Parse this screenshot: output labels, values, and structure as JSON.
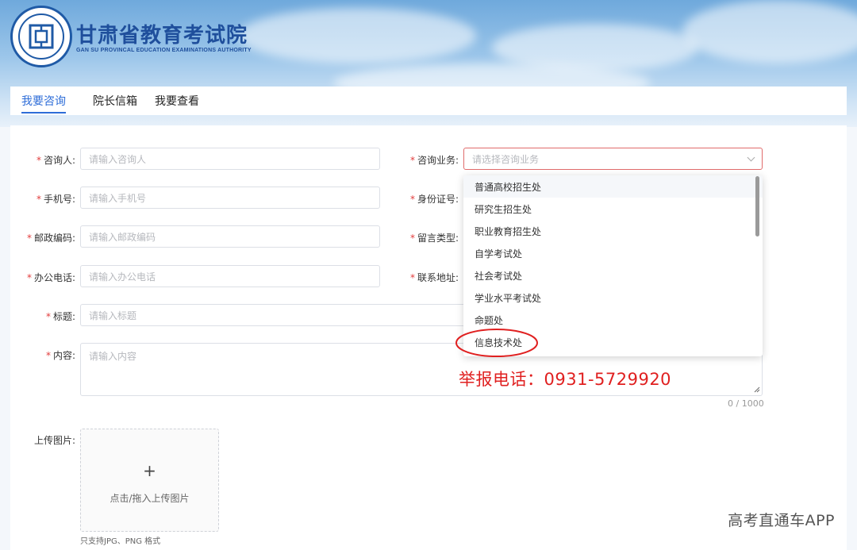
{
  "brand": {
    "title": "甘肃省教育考试院",
    "subtitle": "GAN SU PROVINCAL EDUCATION EXAMINATIONS AUTHORITY",
    "color": "#1f4f9c"
  },
  "tabs": [
    {
      "label": "我要咨询",
      "active": true
    },
    {
      "label": "院长信箱",
      "active": false
    },
    {
      "label": "我要查看",
      "active": false
    }
  ],
  "form": {
    "inquirer": {
      "label": "咨询人:",
      "placeholder": "请输入咨询人"
    },
    "business": {
      "label": "咨询业务:",
      "placeholder": "请选择咨询业务"
    },
    "phone": {
      "label": "手机号:",
      "placeholder": "请输入手机号"
    },
    "id_number": {
      "label": "身份证号:"
    },
    "postcode": {
      "label": "邮政编码:",
      "placeholder": "请输入邮政编码"
    },
    "message_type": {
      "label": "留言类型:"
    },
    "office_phone": {
      "label": "办公电话:",
      "placeholder": "请输入办公电话"
    },
    "address": {
      "label": "联系地址:"
    },
    "subject": {
      "label": "标题:",
      "placeholder": "请输入标题"
    },
    "content": {
      "label": "内容:",
      "placeholder": "请输入内容",
      "counter": "0 / 1000"
    },
    "upload": {
      "label": "上传图片:",
      "button_text": "点击/拖入上传图片",
      "hint": "只支持JPG、PNG 格式"
    }
  },
  "dropdown": {
    "options": [
      "普通高校招生处",
      "研究生招生处",
      "职业教育招生处",
      "自学考试处",
      "社会考试处",
      "学业水平考试处",
      "命题处",
      "信息技术处"
    ],
    "highlighted": "普通高校招生处",
    "circled": "信息技术处"
  },
  "annotation": {
    "text": "举报电话：0931-5729920",
    "color": "#e02020"
  },
  "watermark": "高考直通车APP"
}
